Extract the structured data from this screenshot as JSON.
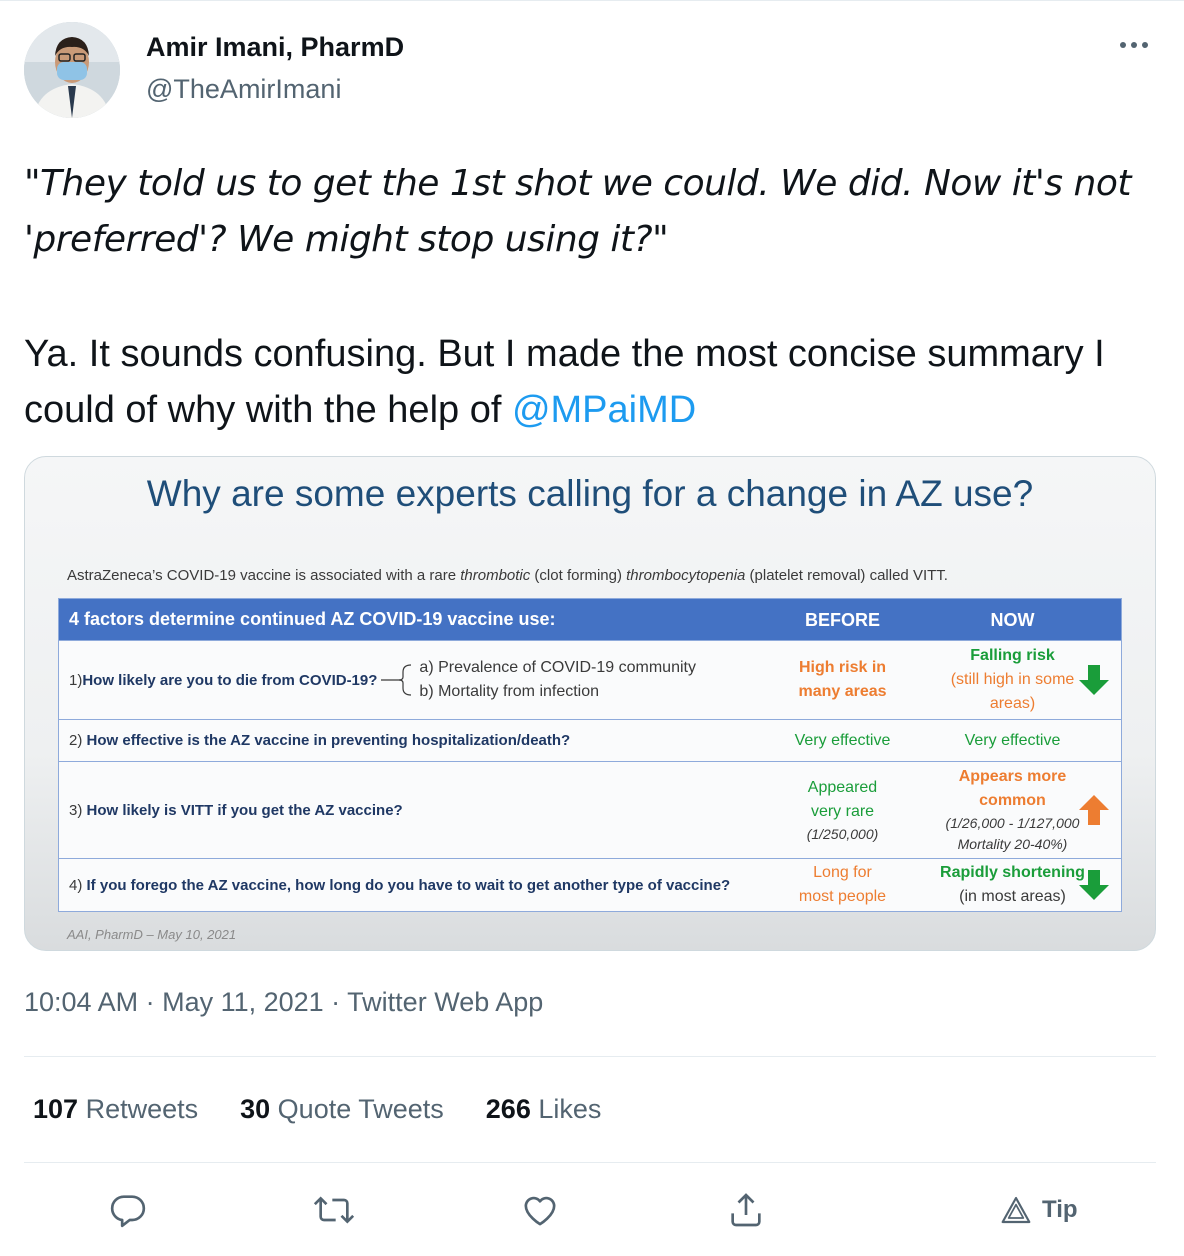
{
  "user": {
    "display_name": "Amir Imani, PharmD",
    "handle": "@TheAmirImani"
  },
  "tweet": {
    "quote_line1": "\"They told us to get the 1st shot we could. We did. Now it's not",
    "quote_line2": "'preferred'?  We might stop using it?\"",
    "body": "Ya. It sounds confusing. But I made the most concise summary I could of why with the help of ",
    "mention": "@MPaiMD"
  },
  "slide": {
    "title": "Why are some experts calling for a change in AZ use?",
    "subtitle_parts": {
      "a": "AstraZeneca’s COVID-19 vaccine is associated with a rare ",
      "b": "thrombotic",
      "c": " (clot forming) ",
      "d": "thrombocytopenia",
      "e": " (platelet removal) called VITT."
    },
    "table": {
      "header": {
        "question": "4 factors determine continued AZ COVID-19 vaccine use:",
        "before": "BEFORE",
        "now": "NOW"
      },
      "rows": [
        {
          "num": "1) ",
          "question": "How likely are you to die from COVID-19?",
          "opt_a": "a) Prevalence of COVID-19 community",
          "opt_b": "b) Mortality from infection",
          "before_1": "High risk in",
          "before_2": "many areas",
          "now_1": "Falling risk",
          "now_2": "(still high in some",
          "now_3": "areas)",
          "trend": "down"
        },
        {
          "num": "2) ",
          "question": "How effective is the AZ vaccine in preventing hospitalization/death?",
          "before": "Very effective",
          "now": "Very effective"
        },
        {
          "num": "3) ",
          "question": "How likely is VITT if you get the AZ vaccine?",
          "before_1": "Appeared",
          "before_2": "very rare",
          "before_3": "(1/250,000)",
          "now_1": "Appears more",
          "now_2": "common",
          "now_3": "(1/26,000 - 1/127,000",
          "now_4": "Mortality 20-40%)",
          "trend": "up"
        },
        {
          "num": "4) ",
          "question": "If you forego the AZ vaccine, how long do you have to wait to get another type of vaccine?",
          "before_1": "Long for",
          "before_2": "most people",
          "now_1": "Rapidly shortening",
          "now_2": "(in most areas)",
          "trend": "down"
        }
      ]
    },
    "footer": "AAI, PharmD – May 10, 2021"
  },
  "meta": "10:04 AM · May 11, 2021 · Twitter Web App",
  "stats": {
    "retweets_count": "107",
    "retweets_label": " Retweets",
    "quotes_count": "30",
    "quotes_label": " Quote Tweets",
    "likes_count": "266",
    "likes_label": " Likes"
  },
  "actions": {
    "tip_label": "Tip"
  },
  "colors": {
    "accent": "#1d9bf0",
    "header_blue": "#4472c4",
    "title_blue": "#1f4e79",
    "orange": "#ed7d31",
    "green": "#1a9d3a"
  }
}
